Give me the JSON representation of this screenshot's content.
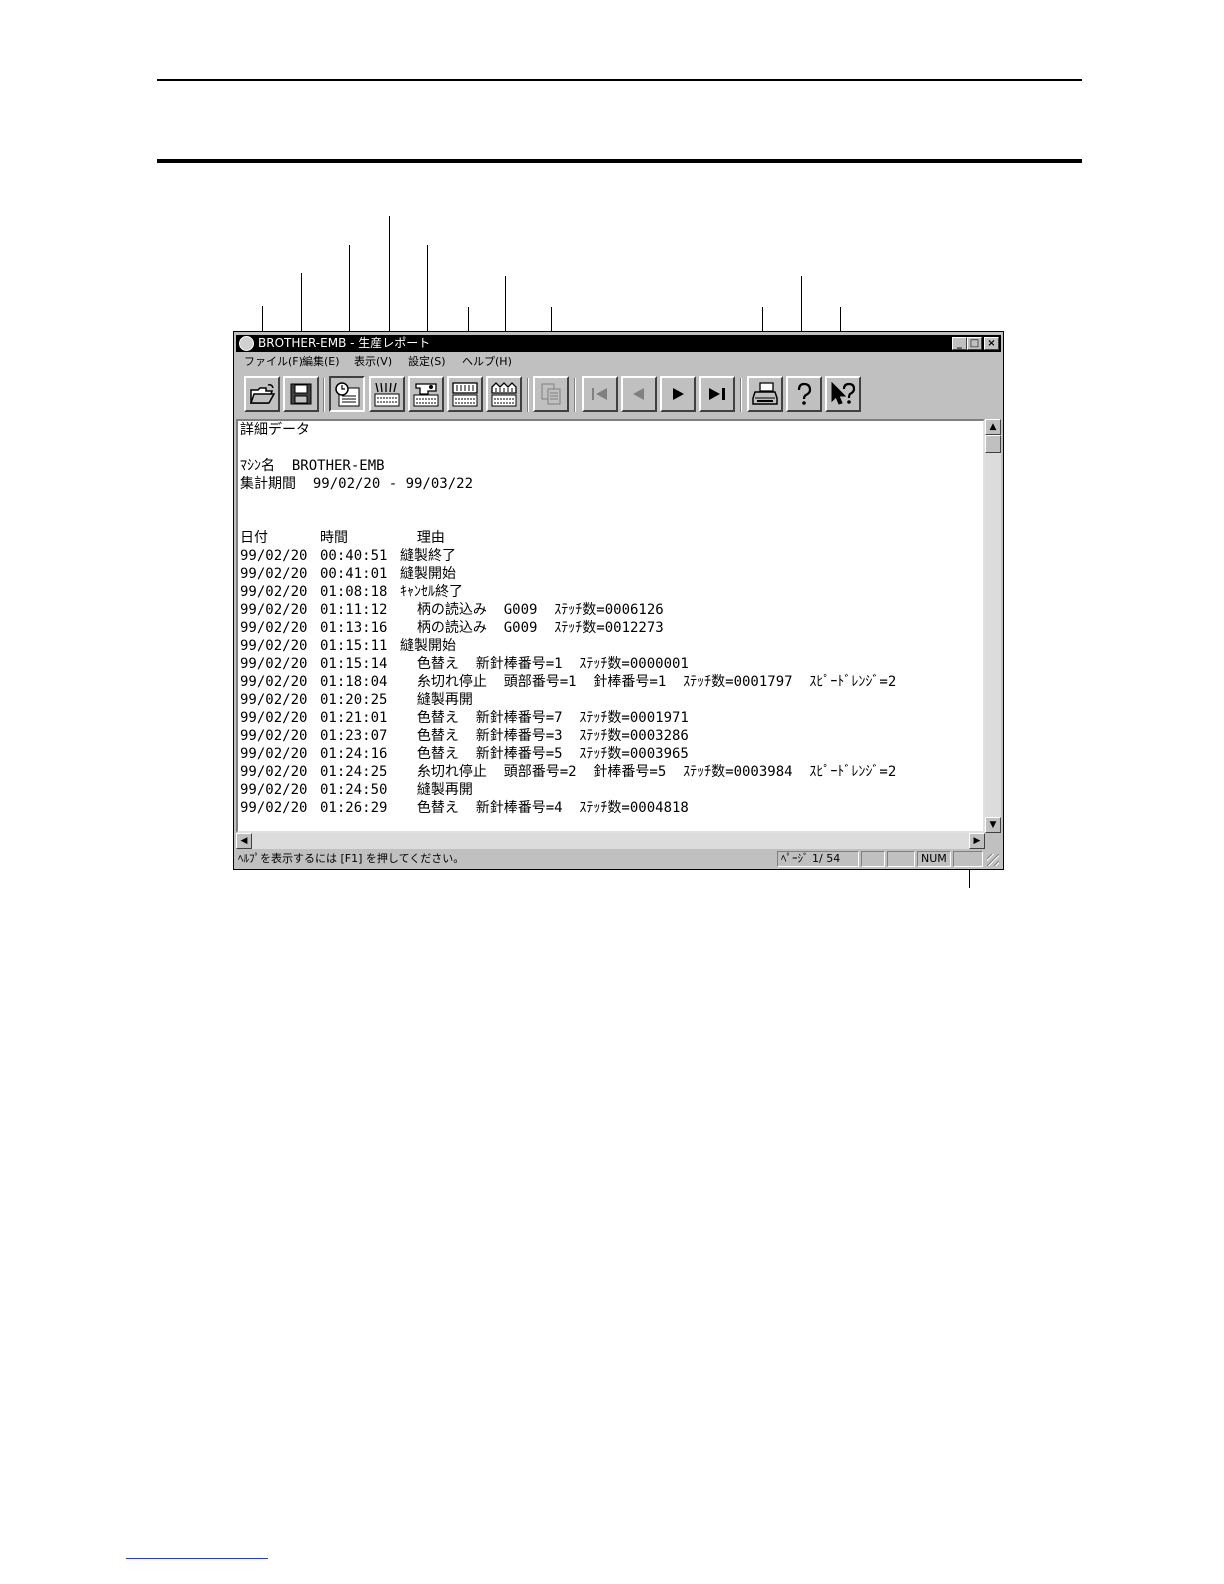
{
  "window": {
    "title": "BROTHER-EMB - 生産レポート",
    "min_label": "_",
    "max_label": "□",
    "close_label": "×"
  },
  "menu": [
    "ファイル(F)",
    "編集(E)",
    "表示(V)",
    "設定(S)",
    "ヘルプ(H)"
  ],
  "toolbar": {
    "icons": [
      "open-folder-icon",
      "save-disk-icon",
      "time-report-icon",
      "needle-report-icon",
      "machine-report-icon",
      "heads-report-icon",
      "heads-multi-report-icon",
      "copy-icon",
      "first-page-icon",
      "prev-page-icon",
      "next-page-icon",
      "last-page-icon",
      "print-icon",
      "help-icon",
      "context-help-icon"
    ]
  },
  "report": {
    "heading": "詳細データ",
    "machine_label": "ﾏｼﾝ名",
    "machine_value": "BROTHER-EMB",
    "period_label": "集計期間",
    "period_value": "99/02/20 - 99/03/22",
    "col_date": "日付",
    "col_time": "時間",
    "col_reason": "理由",
    "rows": [
      {
        "date": "99/02/20",
        "time": "00:40:51",
        "reason": "縫製終了"
      },
      {
        "date": "99/02/20",
        "time": "00:41:01",
        "reason": "縫製開始"
      },
      {
        "date": "99/02/20",
        "time": "01:08:18",
        "reason": "ｷｬﾝｾﾙ終了"
      },
      {
        "date": "99/02/20",
        "time": "01:11:12",
        "reason": "  柄の読込み  G009  ｽﾃｯﾁ数=0006126"
      },
      {
        "date": "99/02/20",
        "time": "01:13:16",
        "reason": "  柄の読込み  G009  ｽﾃｯﾁ数=0012273"
      },
      {
        "date": "99/02/20",
        "time": "01:15:11",
        "reason": "縫製開始"
      },
      {
        "date": "99/02/20",
        "time": "01:15:14",
        "reason": "  色替え  新針棒番号=1  ｽﾃｯﾁ数=0000001"
      },
      {
        "date": "99/02/20",
        "time": "01:18:04",
        "reason": "  糸切れ停止  頭部番号=1  針棒番号=1  ｽﾃｯﾁ数=0001797  ｽﾋﾟｰﾄﾞﾚﾝｼﾞ=2"
      },
      {
        "date": "99/02/20",
        "time": "01:20:25",
        "reason": "  縫製再開"
      },
      {
        "date": "99/02/20",
        "time": "01:21:01",
        "reason": "  色替え  新針棒番号=7  ｽﾃｯﾁ数=0001971"
      },
      {
        "date": "99/02/20",
        "time": "01:23:07",
        "reason": "  色替え  新針棒番号=3  ｽﾃｯﾁ数=0003286"
      },
      {
        "date": "99/02/20",
        "time": "01:24:16",
        "reason": "  色替え  新針棒番号=5  ｽﾃｯﾁ数=0003965"
      },
      {
        "date": "99/02/20",
        "time": "01:24:25",
        "reason": "  糸切れ停止  頭部番号=2  針棒番号=5  ｽﾃｯﾁ数=0003984  ｽﾋﾟｰﾄﾞﾚﾝｼﾞ=2"
      },
      {
        "date": "99/02/20",
        "time": "01:24:50",
        "reason": "  縫製再開"
      },
      {
        "date": "99/02/20",
        "time": "01:26:29",
        "reason": "  色替え  新針棒番号=4  ｽﾃｯﾁ数=0004818"
      }
    ]
  },
  "status": {
    "help_text": "ﾍﾙﾌﾟを表示するには [F1] を押してください。",
    "page_label": "ﾍﾟｰｼﾞ  1/ 54",
    "num_label": "NUM"
  },
  "colors": {
    "titlebar": "#000000",
    "window_face": "#c0c0c0",
    "content_bg": "#ffffff"
  }
}
